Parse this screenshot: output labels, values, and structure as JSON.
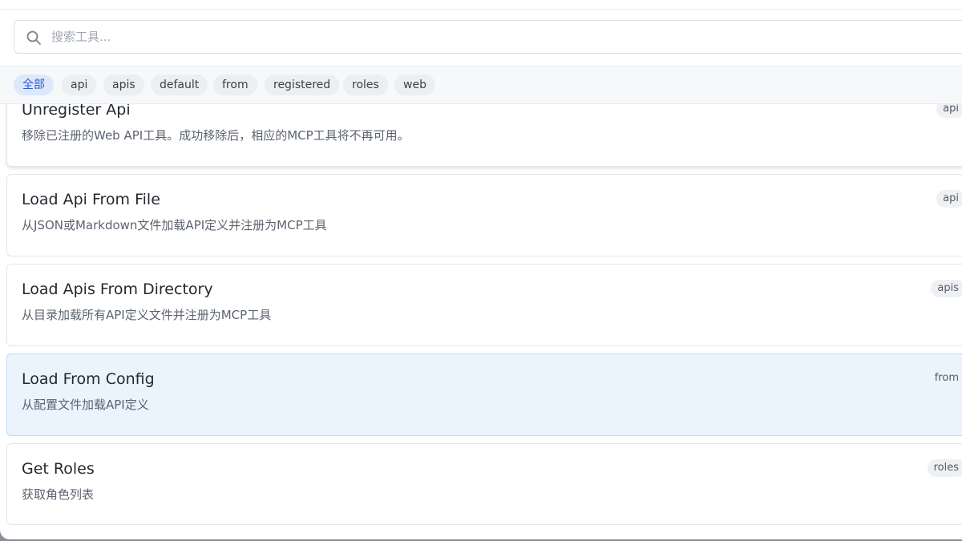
{
  "search": {
    "placeholder": "搜索工具..."
  },
  "filters": [
    {
      "label": "全部",
      "active": true
    },
    {
      "label": "api",
      "active": false
    },
    {
      "label": "apis",
      "active": false
    },
    {
      "label": "default",
      "active": false
    },
    {
      "label": "from",
      "active": false
    },
    {
      "label": "registered",
      "active": false
    },
    {
      "label": "roles",
      "active": false
    },
    {
      "label": "web",
      "active": false
    }
  ],
  "tools": [
    {
      "title": "Unregister Api",
      "description": "移除已注册的Web API工具。成功移除后，相应的MCP工具将不再可用。",
      "tag": "api",
      "selected": false
    },
    {
      "title": "Load Api From File",
      "description": "从JSON或Markdown文件加载API定义并注册为MCP工具",
      "tag": "api",
      "selected": false
    },
    {
      "title": "Load Apis From Directory",
      "description": "从目录加载所有API定义文件并注册为MCP工具",
      "tag": "apis",
      "selected": false
    },
    {
      "title": "Load From Config",
      "description": "从配置文件加载API定义",
      "tag": "from",
      "selected": true
    },
    {
      "title": "Get Roles",
      "description": "获取角色列表",
      "tag": "roles",
      "selected": false
    }
  ],
  "colors": {
    "accent": "#2a5bd7",
    "selected_bg": "#ebf3fd",
    "chip_bg": "#eceef1"
  }
}
